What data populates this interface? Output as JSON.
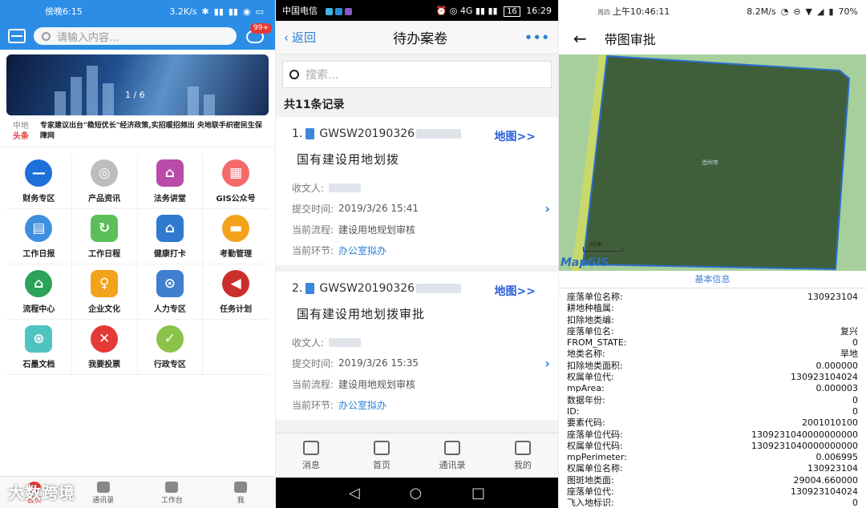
{
  "phone1": {
    "status_time": "傍晚6:15",
    "status_right": [
      "3.2K/s",
      "✱",
      "▮▮",
      "▮▮",
      "◉",
      "▭"
    ],
    "search_placeholder": "请输入内容...",
    "badge": "99+",
    "banner_page": "1 / 6",
    "news_tag_top": "中地",
    "news_tag_bottom": "头条",
    "news_text": "专家建议出台\"稳短优长\"经济政策,实招暖招频出 央地联手织密民生保障网",
    "grid": [
      {
        "label": "财务专区",
        "icon": "minus-icon",
        "glyph": "—",
        "color": "#1e6fd9",
        "shape": "circle"
      },
      {
        "label": "产品资讯",
        "icon": "camera-icon",
        "glyph": "◎",
        "color": "#bdbdbd",
        "shape": "circle"
      },
      {
        "label": "法务讲堂",
        "icon": "house-gear-icon",
        "glyph": "⌂",
        "color": "#b94ca8",
        "shape": "sq"
      },
      {
        "label": "GIS公众号",
        "icon": "building-icon",
        "glyph": "▦",
        "color": "#f26a6a",
        "shape": "circle"
      },
      {
        "label": "工作日报",
        "icon": "calendar-icon",
        "glyph": "▤",
        "color": "#3f8fe0",
        "shape": "circle"
      },
      {
        "label": "工作日程",
        "icon": "schedule-icon",
        "glyph": "↻",
        "color": "#5cbf5a",
        "shape": "sq"
      },
      {
        "label": "健康打卡",
        "icon": "home-icon",
        "glyph": "⌂",
        "color": "#2f7ad0",
        "shape": "sq"
      },
      {
        "label": "考勤管理",
        "icon": "attendance-icon",
        "glyph": "▬",
        "color": "#f3a21c",
        "shape": "circle"
      },
      {
        "label": "流程中心",
        "icon": "home-circle-icon",
        "glyph": "⌂",
        "color": "#2aa25a",
        "shape": "circle"
      },
      {
        "label": "企业文化",
        "icon": "culture-icon",
        "glyph": "♀",
        "color": "#f3a21c",
        "shape": "sq"
      },
      {
        "label": "人力专区",
        "icon": "search-person-icon",
        "glyph": "⊙",
        "color": "#3f7fd0",
        "shape": "sq"
      },
      {
        "label": "任务计划",
        "icon": "megaphone-icon",
        "glyph": "◀",
        "color": "#c9302c",
        "shape": "circle"
      },
      {
        "label": "石墨文档",
        "icon": "doc-search-icon",
        "glyph": "⊛",
        "color": "#4fc3c0",
        "shape": "sq"
      },
      {
        "label": "我要投票",
        "icon": "close-icon",
        "glyph": "✕",
        "color": "#e53935",
        "shape": "circle"
      },
      {
        "label": "行政专区",
        "icon": "check-icon",
        "glyph": "✓",
        "color": "#8bc34a",
        "shape": "circle"
      }
    ],
    "tabs": [
      {
        "label": "首页",
        "active": true
      },
      {
        "label": "通讯录",
        "active": false
      },
      {
        "label": "工作台",
        "active": false
      },
      {
        "label": "我",
        "active": false
      }
    ],
    "watermark": "大数跨境"
  },
  "phone2": {
    "status_carrier": "中国电信",
    "status_icons": "⏰ ◎ 4G ▮▮ ▮▮",
    "status_battery": "16",
    "status_time": "16:29",
    "back_label": "返回",
    "title": "待办案卷",
    "more": "•••",
    "search_placeholder": "搜索...",
    "count": "共11条记录",
    "map_link": "地图>>",
    "records": [
      {
        "index": "1.",
        "code": "GWSW20190326",
        "title": "国有建设用地划拨",
        "receiver_label": "收文人:",
        "submit_label": "提交时间:",
        "submit_time": "2019/3/26 15:41",
        "flow_label": "当前流程:",
        "flow": "建设用地规划审核",
        "step_label": "当前环节:",
        "step": "办公室拟办"
      },
      {
        "index": "2.",
        "code": "GWSW20190326",
        "title": "国有建设用地划拨审批",
        "receiver_label": "收文人:",
        "submit_label": "提交时间:",
        "submit_time": "2019/3/26 15:35",
        "flow_label": "当前流程:",
        "flow": "建设用地规划审核",
        "step_label": "当前环节:",
        "step": "办公室拟办"
      }
    ],
    "tabs": [
      {
        "label": "消息",
        "icon": "message-icon"
      },
      {
        "label": "首页",
        "icon": "home-icon"
      },
      {
        "label": "通讯录",
        "icon": "contacts-icon"
      },
      {
        "label": "我的",
        "icon": "menu-icon"
      }
    ]
  },
  "phone3": {
    "status_day": "周四",
    "status_time": "上午10:46:11",
    "status_right": [
      "8.2M/s",
      "◔",
      "⊖",
      "▼",
      "◢",
      "▮",
      "70%"
    ],
    "title": "带图审批",
    "map_logo": "MapGIS",
    "scale_label": "50米",
    "map_label": "沧州市",
    "info_title": "基本信息",
    "fields": [
      {
        "k": "座落单位名称:",
        "v": "130923104"
      },
      {
        "k": "耕地种植属:",
        "v": ""
      },
      {
        "k": "扣除地类编:",
        "v": ""
      },
      {
        "k": "座落单位名:",
        "v": "复兴"
      },
      {
        "k": "FROM_STATE:",
        "v": "0"
      },
      {
        "k": "地类名称:",
        "v": "旱地"
      },
      {
        "k": "扣除地类面积:",
        "v": "0.000000"
      },
      {
        "k": "权属单位代:",
        "v": "130923104024"
      },
      {
        "k": "mpArea:",
        "v": "0.000003"
      },
      {
        "k": "数据年份:",
        "v": "0"
      },
      {
        "k": "ID:",
        "v": "0"
      },
      {
        "k": "要素代码:",
        "v": "2001010100"
      },
      {
        "k": "座落单位代码:",
        "v": "1309231040000000000"
      },
      {
        "k": "权属单位代码:",
        "v": "1309231040000000000"
      },
      {
        "k": "mpPerimeter:",
        "v": "0.006995"
      },
      {
        "k": "权属单位名称:",
        "v": "130923104"
      },
      {
        "k": "图斑地类面:",
        "v": "29004.660000"
      },
      {
        "k": "座落单位代:",
        "v": "130923104024"
      },
      {
        "k": "飞入地标识:",
        "v": "0"
      }
    ]
  }
}
